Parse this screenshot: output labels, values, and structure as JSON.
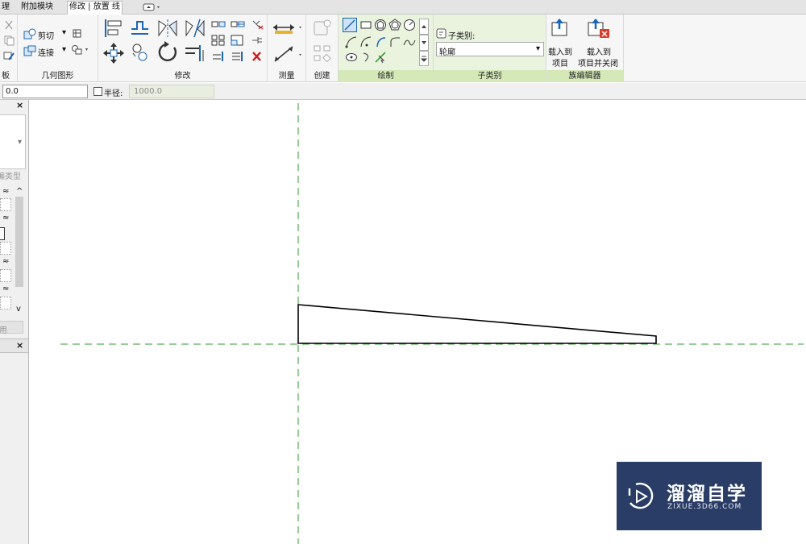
{
  "tabs": {
    "management_partial": "理",
    "addins": "附加模块",
    "modify_place_line": "修改 | 放置 线"
  },
  "ribbon": {
    "clipboard_partial_label": "板",
    "geometry": {
      "label": "几何图形",
      "cut_label": "剪切",
      "join_label": "连接"
    },
    "modify_label": "修改",
    "measure_label": "测量",
    "create_label": "创建",
    "draw_label": "绘制",
    "subcategory": {
      "label": "子类别",
      "field_label": "子类别:",
      "selected": "轮廓"
    },
    "family_editor": {
      "label": "族编辑器",
      "load_into_project": "载入到\n项目",
      "load_into_project_l1": "载入到",
      "load_into_project_l2": "项目",
      "load_close_l1": "载入到",
      "load_close_l2": "项目并关闭"
    }
  },
  "options_bar": {
    "offset_value": "0.0",
    "radius_label": "半径:",
    "radius_value": "1000.0"
  },
  "left_pane": {
    "type_partial": "编类型",
    "apply_partial": "用"
  },
  "watermark": {
    "name": "溜溜自学",
    "url": "ZIXUE.3D66.COM"
  },
  "colors": {
    "ribbon_bg": "#f6f6f6",
    "ribbon_accent": "#eaf3de",
    "ref_plane": "#2e9a2e",
    "watermark_bg": "#2a3d66"
  }
}
